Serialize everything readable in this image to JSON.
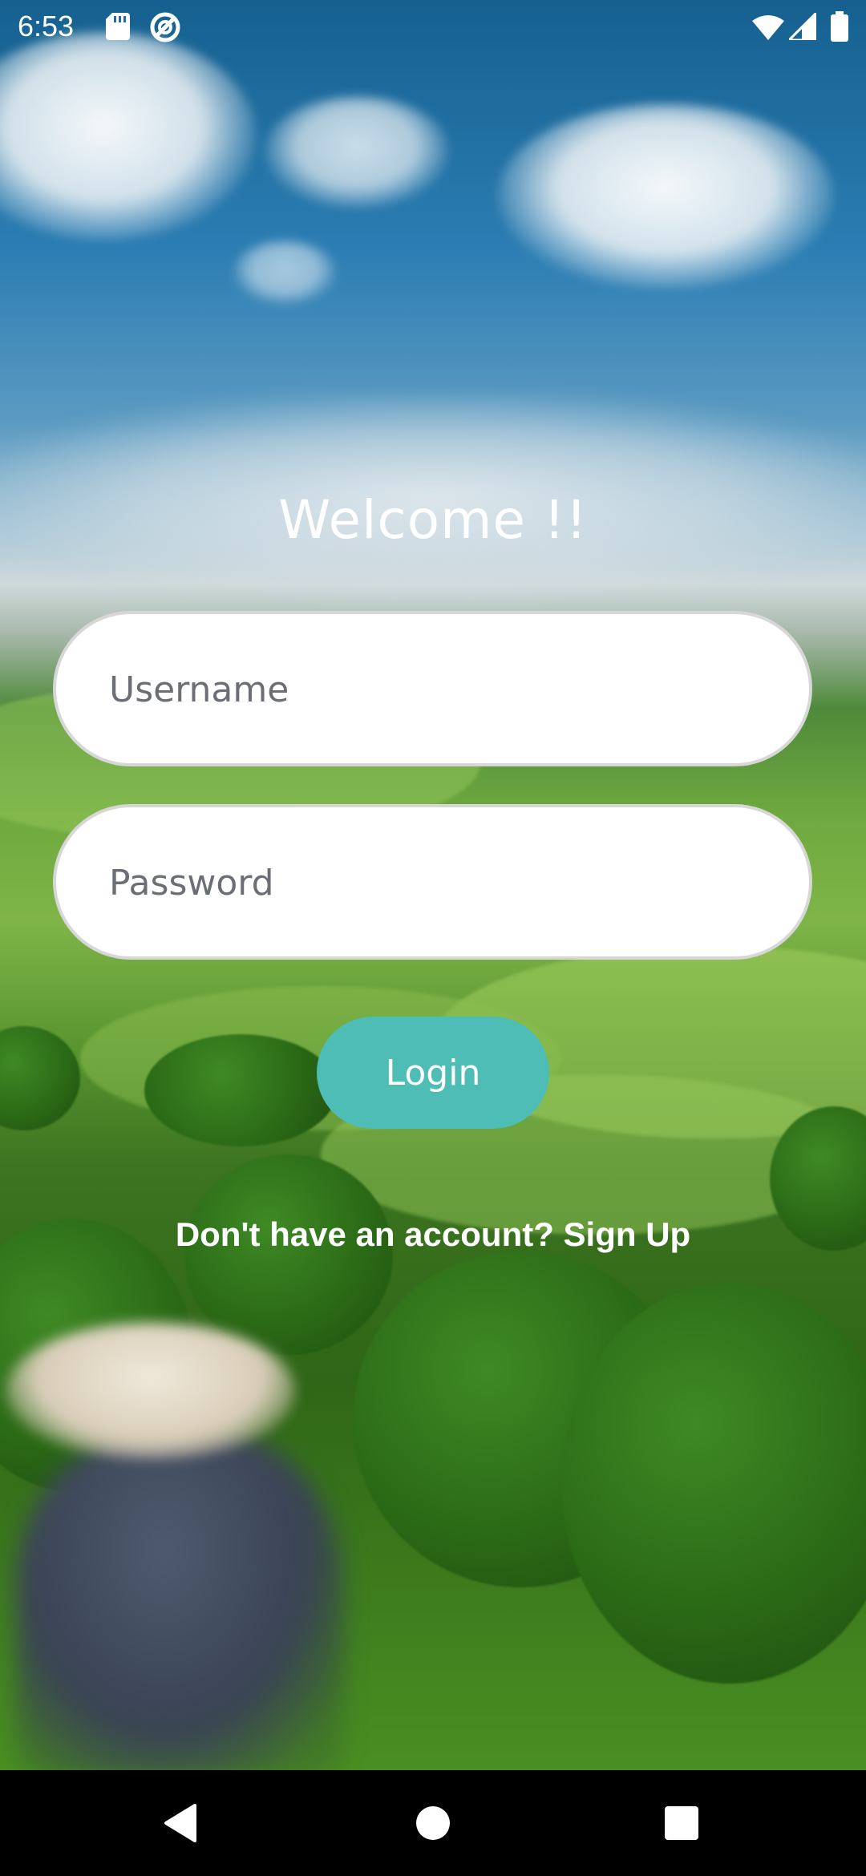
{
  "status_bar": {
    "time": "6:53",
    "left_icons": [
      "sd-card-icon",
      "do-not-disturb-icon"
    ],
    "right_icons": [
      "wifi-icon",
      "cell-signal-icon",
      "battery-icon"
    ]
  },
  "login": {
    "title": "Welcome !!",
    "username": {
      "placeholder": "Username",
      "value": ""
    },
    "password": {
      "placeholder": "Password",
      "value": ""
    },
    "login_button": "Login",
    "signup_link": "Don't have an account? Sign Up"
  },
  "nav_bar": {
    "buttons": [
      "back-icon",
      "home-icon",
      "recents-icon"
    ]
  },
  "colors": {
    "accent": "#4dbdb6",
    "input_background": "#ffffff",
    "nav_bar": "#000000"
  }
}
